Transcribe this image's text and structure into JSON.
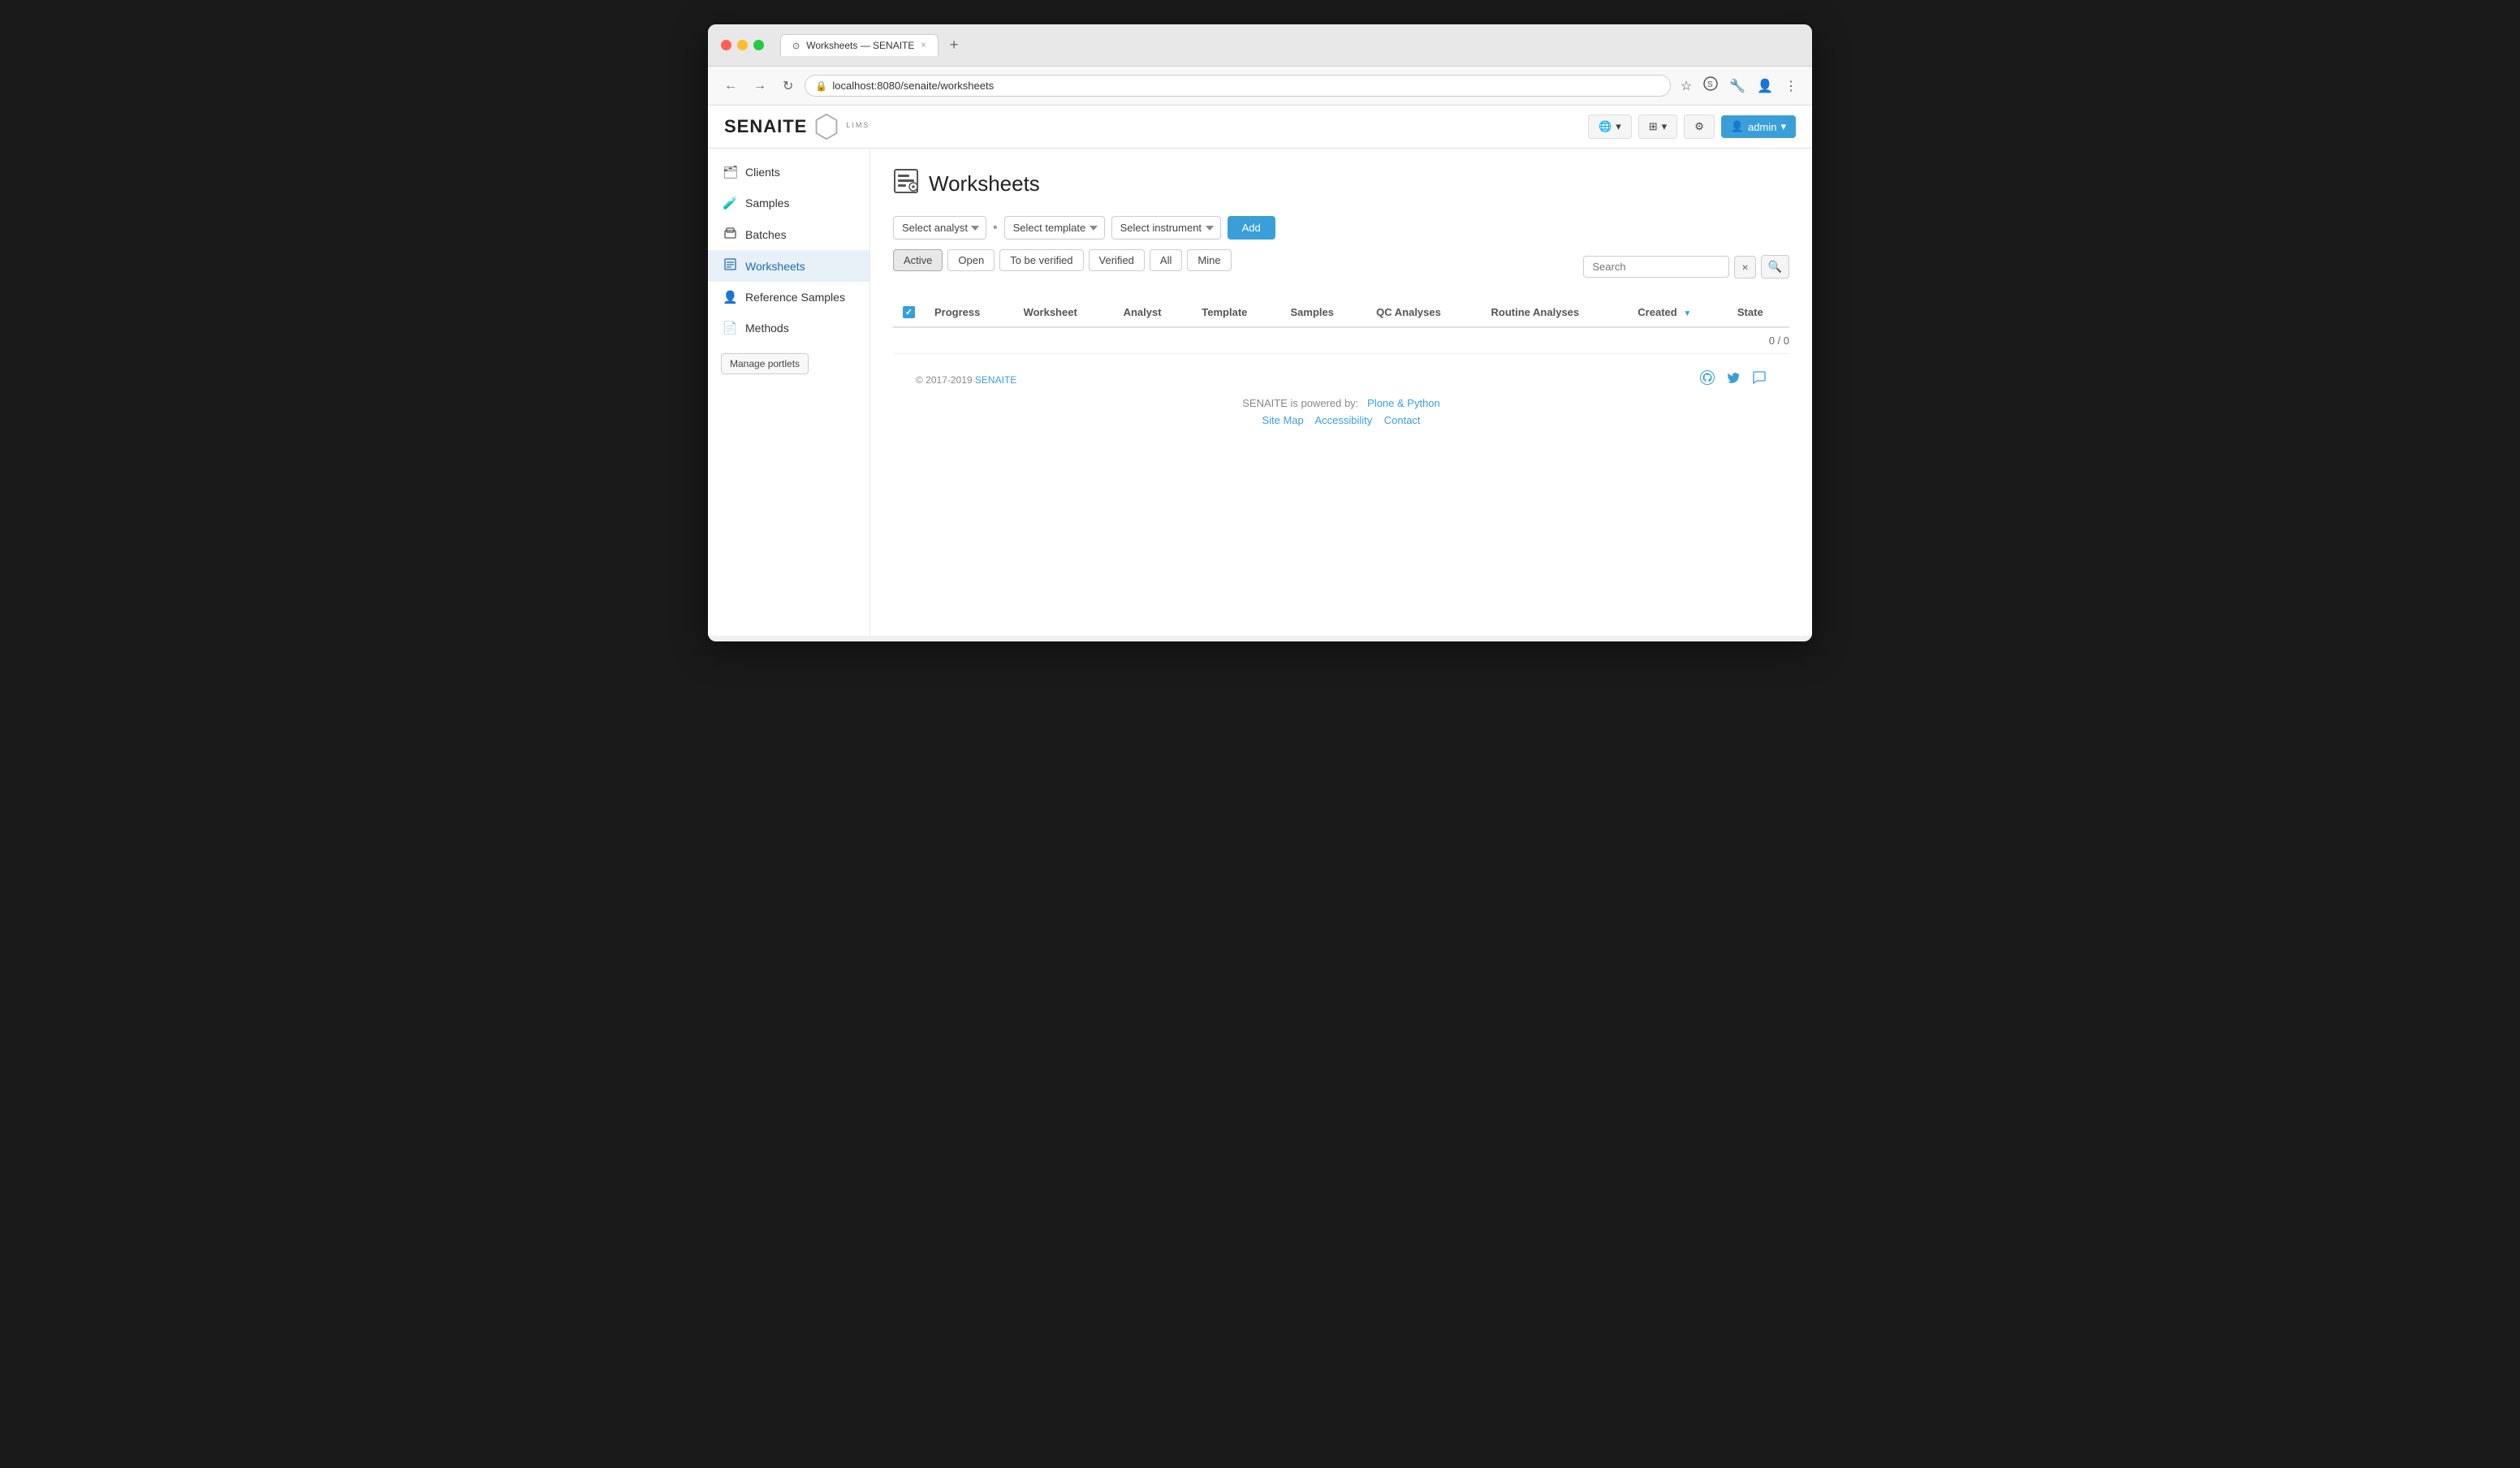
{
  "browser": {
    "tab_title": "Worksheets — SENAITE",
    "url": "localhost:8080/senaite/worksheets",
    "tab_close": "×",
    "tab_add": "+"
  },
  "header": {
    "logo_text": "SENAITE",
    "logo_sub": "LIMS",
    "globe_btn": "🌐",
    "grid_btn": "⊞",
    "gear_btn": "⚙",
    "admin_btn": "admin",
    "admin_icon": "👤"
  },
  "sidebar": {
    "items": [
      {
        "label": "Clients",
        "icon": "🗂"
      },
      {
        "label": "Samples",
        "icon": "🧪"
      },
      {
        "label": "Batches",
        "icon": "📦"
      },
      {
        "label": "Worksheets",
        "icon": "📋",
        "active": true
      },
      {
        "label": "Reference Samples",
        "icon": "👤"
      },
      {
        "label": "Methods",
        "icon": "📄"
      }
    ],
    "manage_portlets_label": "Manage portlets"
  },
  "page": {
    "title": "Worksheets",
    "title_icon": "📋"
  },
  "toolbar": {
    "select_analyst_label": "Select analyst",
    "select_template_label": "Select template",
    "select_instrument_label": "Select instrument",
    "add_label": "Add",
    "dot": "•"
  },
  "filters": {
    "buttons": [
      {
        "label": "Active",
        "active": true
      },
      {
        "label": "Open",
        "active": false
      },
      {
        "label": "To be verified",
        "active": false
      },
      {
        "label": "Verified",
        "active": false
      },
      {
        "label": "All",
        "active": false
      },
      {
        "label": "Mine",
        "active": false
      }
    ]
  },
  "search": {
    "placeholder": "Search",
    "clear_icon": "×",
    "search_icon": "🔍"
  },
  "table": {
    "columns": [
      {
        "label": ""
      },
      {
        "label": "Progress"
      },
      {
        "label": "Worksheet"
      },
      {
        "label": "Analyst"
      },
      {
        "label": "Template"
      },
      {
        "label": "Samples"
      },
      {
        "label": "QC Analyses"
      },
      {
        "label": "Routine Analyses"
      },
      {
        "label": "Created",
        "sort": true
      },
      {
        "label": "State"
      }
    ],
    "rows": [],
    "count_label": "0 / 0"
  },
  "footer": {
    "copyright": "© 2017-2019",
    "senaite_link": "SENAITE",
    "powered_by": "SENAITE is powered by:",
    "plone_python": "Plone & Python",
    "site_map": "Site Map",
    "accessibility": "Accessibility",
    "contact": "Contact",
    "github_icon": "⚙",
    "twitter_icon": "🐦",
    "chat_icon": "💬"
  }
}
